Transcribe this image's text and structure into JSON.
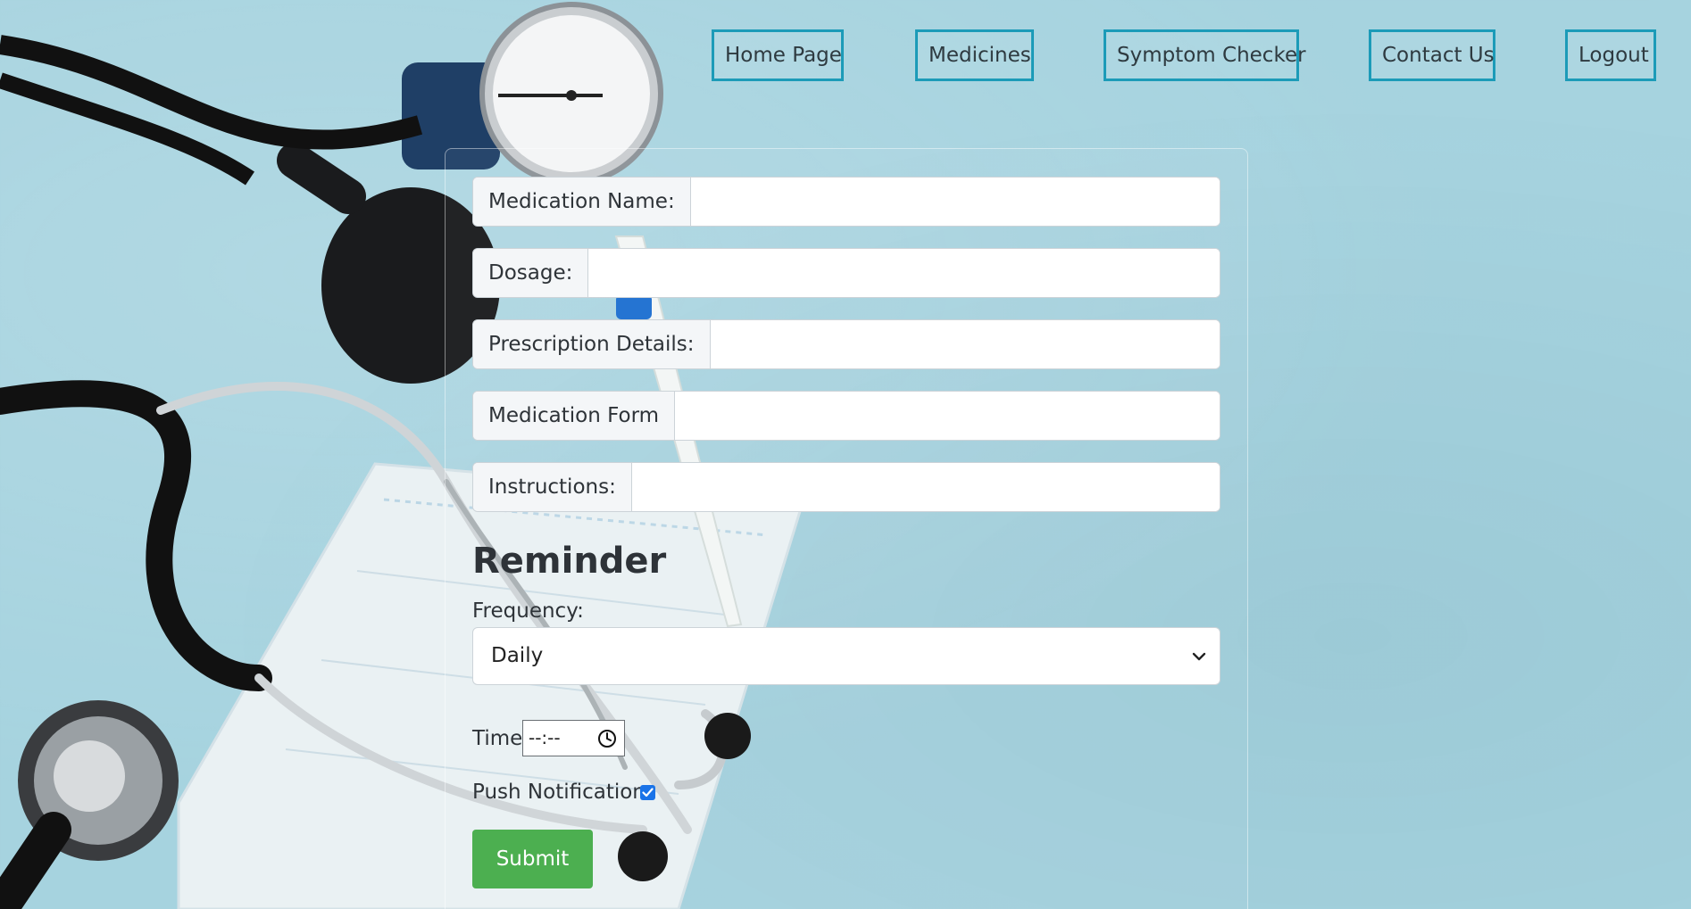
{
  "nav": {
    "items": [
      {
        "label": "Home Page"
      },
      {
        "label": "Medicines"
      },
      {
        "label": "Symptom Checker"
      },
      {
        "label": "Contact Us"
      },
      {
        "label": "Logout"
      }
    ]
  },
  "form": {
    "fields": [
      {
        "label": "Medication Name:",
        "value": ""
      },
      {
        "label": "Dosage:",
        "value": ""
      },
      {
        "label": "Prescription Details:",
        "value": ""
      },
      {
        "label": "Medication Form",
        "value": ""
      },
      {
        "label": "Instructions:",
        "value": ""
      }
    ],
    "reminder": {
      "heading": "Reminder",
      "frequency_label": "Frequency:",
      "frequency_value": "Daily",
      "time_label": "Time:",
      "time_value": "--:--",
      "push_label": "Push Notification:",
      "push_checked": true
    },
    "submit_label": "Submit"
  },
  "colors": {
    "background": "#a6d3df",
    "nav_border": "#1c9bb8",
    "submit": "#4caf50"
  },
  "background_image": "stethoscope-blood-pressure-monitor-thermometer-mask"
}
